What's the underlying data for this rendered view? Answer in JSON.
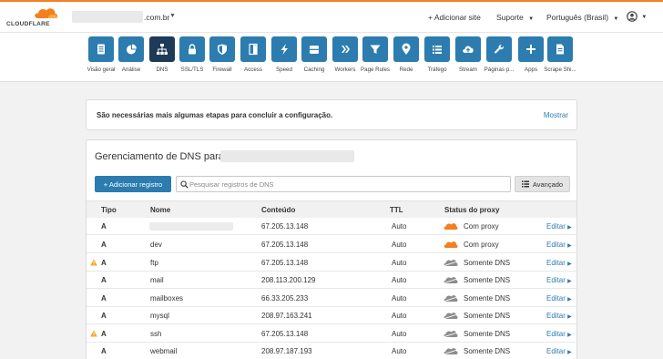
{
  "header": {
    "logo_text": "CLOUDFLARE",
    "domain_suffix": ".com.br",
    "add_site": "+ Adicionar site",
    "support": "Suporte",
    "language": "Português (Brasil)"
  },
  "nav": [
    {
      "label": "Visão geral",
      "icon": "document-icon",
      "active": false
    },
    {
      "label": "Análise",
      "icon": "pie-chart-icon",
      "active": false
    },
    {
      "label": "DNS",
      "icon": "network-icon",
      "active": true
    },
    {
      "label": "SSL/TLS",
      "icon": "lock-icon",
      "active": false
    },
    {
      "label": "Firewall",
      "icon": "shield-icon",
      "active": false
    },
    {
      "label": "Access",
      "icon": "door-icon",
      "active": false
    },
    {
      "label": "Speed",
      "icon": "lightning-icon",
      "active": false
    },
    {
      "label": "Caching",
      "icon": "storage-icon",
      "active": false
    },
    {
      "label": "Workers",
      "icon": "workers-icon",
      "active": false
    },
    {
      "label": "Page Rules",
      "icon": "filter-icon",
      "active": false
    },
    {
      "label": "Rede",
      "icon": "location-pin-icon",
      "active": false
    },
    {
      "label": "Tráfego",
      "icon": "list-icon",
      "active": false
    },
    {
      "label": "Stream",
      "icon": "cloud-upload-icon",
      "active": false
    },
    {
      "label": "Páginas p...",
      "icon": "wrench-icon",
      "active": false
    },
    {
      "label": "Apps",
      "icon": "plus-icon",
      "active": false
    },
    {
      "label": "Scrape Shi...",
      "icon": "file-icon",
      "active": false
    }
  ],
  "notice": {
    "text": "São necessárias mais algumas etapas para concluir a configuração.",
    "link": "Mostrar"
  },
  "dns": {
    "title": "Gerenciamento de DNS para",
    "add_button": "+ Adicionar registro",
    "search_placeholder": "Pesquisar registros de DNS",
    "advanced": "Avançado",
    "columns": [
      "Tipo",
      "Nome",
      "Conteúdo",
      "TTL",
      "Status do proxy"
    ],
    "records": [
      {
        "type": "A",
        "name": "",
        "content": "67.205.13.148",
        "ttl": "Auto",
        "proxy": "Com proxy",
        "proxied": true,
        "warning": false,
        "action": "Editar"
      },
      {
        "type": "A",
        "name": "dev",
        "content": "67.205.13.148",
        "ttl": "Auto",
        "proxy": "Com proxy",
        "proxied": true,
        "warning": false,
        "action": "Editar"
      },
      {
        "type": "A",
        "name": "ftp",
        "content": "67.205.13.148",
        "ttl": "Auto",
        "proxy": "Somente DNS",
        "proxied": false,
        "warning": true,
        "action": "Editar"
      },
      {
        "type": "A",
        "name": "mail",
        "content": "208.113.200.129",
        "ttl": "Auto",
        "proxy": "Somente DNS",
        "proxied": false,
        "warning": false,
        "action": "Editar"
      },
      {
        "type": "A",
        "name": "mailboxes",
        "content": "66.33.205.233",
        "ttl": "Auto",
        "proxy": "Somente DNS",
        "proxied": false,
        "warning": false,
        "action": "Editar"
      },
      {
        "type": "A",
        "name": "mysql",
        "content": "208.97.163.241",
        "ttl": "Auto",
        "proxy": "Somente DNS",
        "proxied": false,
        "warning": false,
        "action": "Editar"
      },
      {
        "type": "A",
        "name": "ssh",
        "content": "67.205.13.148",
        "ttl": "Auto",
        "proxy": "Somente DNS",
        "proxied": false,
        "warning": true,
        "action": "Editar"
      },
      {
        "type": "A",
        "name": "webmail",
        "content": "208.97.187.193",
        "ttl": "Auto",
        "proxy": "Somente DNS",
        "proxied": false,
        "warning": false,
        "action": "Editar"
      }
    ]
  },
  "colors": {
    "accent_orange": "#f38020",
    "brand_blue": "#2c7cb0",
    "active_nav": "#1d3b58",
    "warning": "#f5a623",
    "dns_only_cloud": "#8c8c8c"
  }
}
